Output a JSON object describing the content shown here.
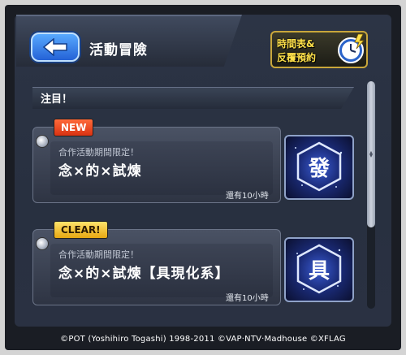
{
  "header": {
    "back_icon": "arrow-left-icon",
    "title": "活動冒險",
    "schedule_line1": "時間表&",
    "schedule_line2": "反覆預約",
    "schedule_icon": "clock-icon"
  },
  "section": {
    "title": "注目！"
  },
  "quests": [
    {
      "badge": "NEW",
      "subtitle": "合作活動期間限定！",
      "title": "念×的×試煉",
      "time_left": "還有10小時",
      "icon_char": "發"
    },
    {
      "badge": "CLEAR!",
      "subtitle": "合作活動期間限定！",
      "title": "念×的×試煉【具現化系】",
      "time_left": "還有10小時",
      "icon_char": "具"
    }
  ],
  "footer": {
    "copyright": "©POT (Yoshihiro Togashi) 1998-2011 ©VAP·NTV·Madhouse ©XFLAG"
  },
  "colors": {
    "badge_new": "#e2431a",
    "badge_clear": "#f5c431",
    "back_button": "#3a86f0",
    "background": "#283040"
  }
}
